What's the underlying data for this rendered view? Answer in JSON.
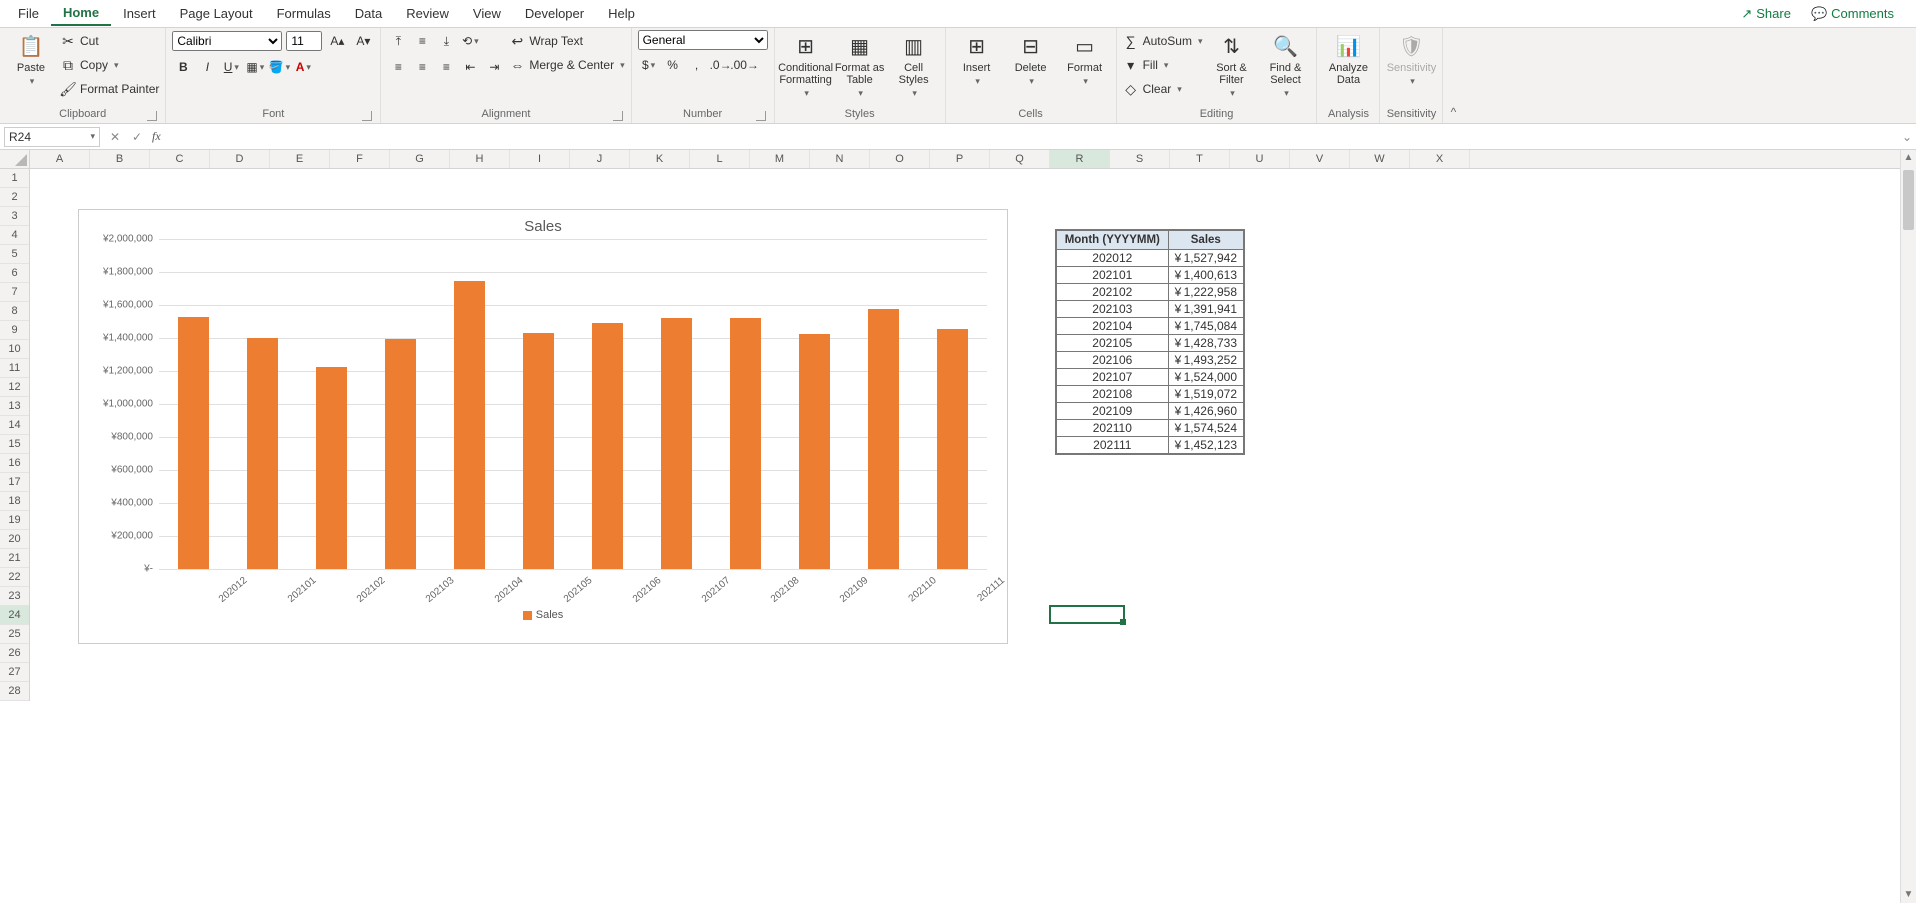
{
  "tabs": [
    "File",
    "Home",
    "Insert",
    "Page Layout",
    "Formulas",
    "Data",
    "Review",
    "View",
    "Developer",
    "Help"
  ],
  "active_tab": "Home",
  "share_label": "Share",
  "comments_label": "Comments",
  "clipboard": {
    "paste": "Paste",
    "cut": "Cut",
    "copy": "Copy",
    "painter": "Format Painter",
    "group": "Clipboard"
  },
  "font": {
    "name": "Calibri",
    "size": "11",
    "group": "Font"
  },
  "alignment": {
    "wrap": "Wrap Text",
    "merge": "Merge & Center",
    "group": "Alignment"
  },
  "number": {
    "format": "General",
    "group": "Number"
  },
  "styles": {
    "cond": "Conditional Formatting",
    "fat": "Format as Table",
    "cell": "Cell Styles",
    "group": "Styles"
  },
  "cells": {
    "insert": "Insert",
    "delete": "Delete",
    "format": "Format",
    "group": "Cells"
  },
  "editing": {
    "autosum": "AutoSum",
    "fill": "Fill",
    "clear": "Clear",
    "sort": "Sort & Filter",
    "find": "Find & Select",
    "group": "Editing"
  },
  "analysis": {
    "analyze": "Analyze Data",
    "group": "Analysis"
  },
  "sensitivity": {
    "label": "Sensitivity",
    "group": "Sensitivity"
  },
  "namebox": "R24",
  "formula": "",
  "columns": [
    "A",
    "B",
    "C",
    "D",
    "E",
    "F",
    "G",
    "H",
    "I",
    "J",
    "K",
    "L",
    "M",
    "N",
    "O",
    "P",
    "Q",
    "R",
    "S",
    "T",
    "U",
    "V",
    "W",
    "X"
  ],
  "active_col_index": 17,
  "row_count": 28,
  "active_row": 24,
  "chart_data": {
    "type": "bar",
    "title": "Sales",
    "legend": "Sales",
    "ylim": [
      0,
      2000000
    ],
    "ystep": 200000,
    "yticks": [
      "¥-",
      "¥200,000",
      "¥400,000",
      "¥600,000",
      "¥800,000",
      "¥1,000,000",
      "¥1,200,000",
      "¥1,400,000",
      "¥1,600,000",
      "¥1,800,000",
      "¥2,000,000"
    ],
    "categories": [
      "202012",
      "202101",
      "202102",
      "202103",
      "202104",
      "202105",
      "202106",
      "202107",
      "202108",
      "202109",
      "202110",
      "202111"
    ],
    "values": [
      1527942,
      1400613,
      1222958,
      1391941,
      1745084,
      1428733,
      1493252,
      1524000,
      1519072,
      1426960,
      1574524,
      1452123
    ]
  },
  "table": {
    "headers": [
      "Month (YYYYMM)",
      "Sales"
    ],
    "currency": "¥",
    "rows": [
      [
        "202012",
        "1,527,942"
      ],
      [
        "202101",
        "1,400,613"
      ],
      [
        "202102",
        "1,222,958"
      ],
      [
        "202103",
        "1,391,941"
      ],
      [
        "202104",
        "1,745,084"
      ],
      [
        "202105",
        "1,428,733"
      ],
      [
        "202106",
        "1,493,252"
      ],
      [
        "202107",
        "1,524,000"
      ],
      [
        "202108",
        "1,519,072"
      ],
      [
        "202109",
        "1,426,960"
      ],
      [
        "202110",
        "1,574,524"
      ],
      [
        "202111",
        "1,452,123"
      ]
    ]
  }
}
